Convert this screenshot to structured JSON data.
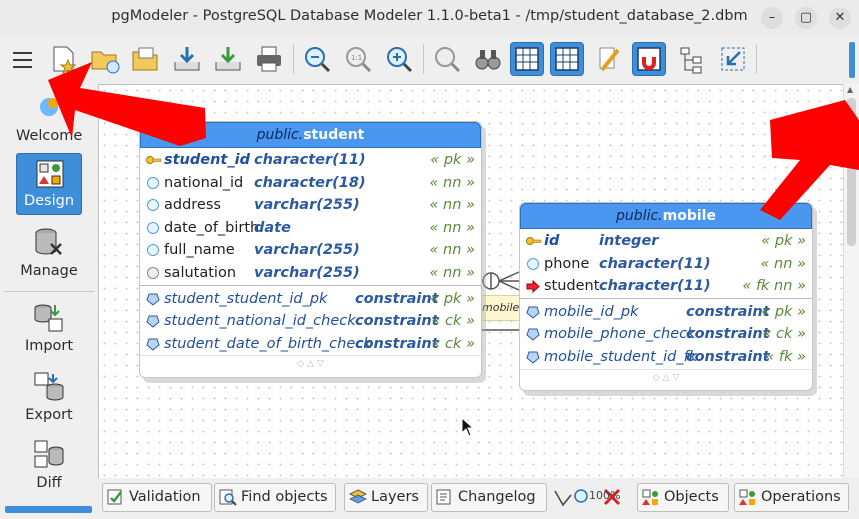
{
  "window": {
    "title": "pgModeler - PostgreSQL Database Modeler 1.1.0-beta1 - /tmp/student_database_2.dbm"
  },
  "sidebar": {
    "items": [
      {
        "label": "Welcome"
      },
      {
        "label": "Design"
      },
      {
        "label": "Manage"
      },
      {
        "label": "Import"
      },
      {
        "label": "Export"
      },
      {
        "label": "Diff"
      }
    ]
  },
  "tables": {
    "student": {
      "schema": "public.",
      "name": "student",
      "columns": [
        {
          "name": "student_id",
          "type": "character(11)",
          "tag": "« pk »"
        },
        {
          "name": "national_id",
          "type": "character(18)",
          "tag": "« nn »"
        },
        {
          "name": "address",
          "type": "varchar(255)",
          "tag": "« nn »"
        },
        {
          "name": "date_of_birth",
          "type": "date",
          "tag": "« nn »"
        },
        {
          "name": "full_name",
          "type": "varchar(255)",
          "tag": "« nn »"
        },
        {
          "name": "salutation",
          "type": "varchar(255)",
          "tag": "« nn »"
        }
      ],
      "constraints": [
        {
          "name": "student_student_id_pk",
          "type": "constraint",
          "tag": "« pk »"
        },
        {
          "name": "student_national_id_check",
          "type": "constraint",
          "tag": "« ck »"
        },
        {
          "name": "student_date_of_birth_check",
          "type": "constraint",
          "tag": "« ck »"
        }
      ]
    },
    "mobile": {
      "schema": "public.",
      "name": "mobile",
      "columns": [
        {
          "name": "id",
          "type": "integer",
          "tag": "« pk »"
        },
        {
          "name": "phone",
          "type": "character(11)",
          "tag": "« nn »"
        },
        {
          "name": "student",
          "type": "character(11)",
          "tag": "« fk nn »"
        }
      ],
      "constraints": [
        {
          "name": "mobile_id_pk",
          "type": "constraint",
          "tag": "« pk »"
        },
        {
          "name": "mobile_phone_check",
          "type": "constraint",
          "tag": "« ck »"
        },
        {
          "name": "mobile_student_id_fk",
          "type": "constraint",
          "tag": "« fk »"
        }
      ]
    }
  },
  "relationship": {
    "label": "mobile_stu"
  },
  "bottombar": {
    "validation": "Validation",
    "find_objects": "Find objects",
    "layers": "Layers",
    "changelog": "Changelog",
    "zoom_text": "100%",
    "objects": "Objects",
    "operations": "Operations"
  },
  "colors": {
    "accent": "#3e8ed9",
    "table_header": "#4a97ef",
    "annotation": "#ff0000"
  }
}
